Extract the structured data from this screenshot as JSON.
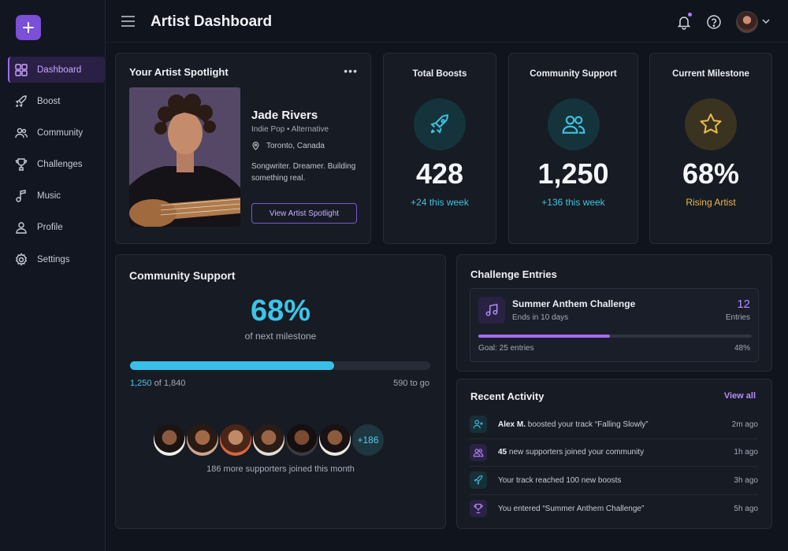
{
  "header": {
    "title": "Artist Dashboard"
  },
  "sidebar": {
    "items": [
      {
        "label": "Dashboard",
        "icon": "grid-icon",
        "active": true
      },
      {
        "label": "Boost",
        "icon": "rocket-icon"
      },
      {
        "label": "Community",
        "icon": "users-icon"
      },
      {
        "label": "Challenges",
        "icon": "trophy-icon"
      },
      {
        "label": "Music",
        "icon": "music-note-icon"
      },
      {
        "label": "Profile",
        "icon": "user-icon"
      },
      {
        "label": "Settings",
        "icon": "gear-icon"
      }
    ]
  },
  "spotlight": {
    "title": "Your Artist Spotlight",
    "name": "Jade Rivers",
    "genre": "Indie Pop • Alternative",
    "location": "Toronto, Canada",
    "bio": "Songwriter. Dreamer. Building something real.",
    "button": "View Artist Spotlight"
  },
  "stats": [
    {
      "title": "Total Boosts",
      "value": "428",
      "sub": "+24 this week",
      "accent": "#3fc3df",
      "icon": "rocket-icon"
    },
    {
      "title": "Community Support",
      "value": "1,250",
      "sub": "+136 this week",
      "accent": "#3fc3df",
      "icon": "users-icon"
    },
    {
      "title": "Current Milestone",
      "value": "68%",
      "sub": "Rising Artist",
      "accent": "#e8b84a",
      "icon": "star-icon"
    }
  ],
  "community": {
    "title": "Community Support",
    "percent": "68%",
    "percent_sub": "of next milestone",
    "progress": 0.68,
    "current": "1,250",
    "of_total": " of 1,840",
    "remaining": "590 to go",
    "more_count": "+186",
    "caption": "186 more supporters joined this month"
  },
  "challenge": {
    "title": "Challenge Entries",
    "name": "Summer Anthem Challenge",
    "ends": "Ends in 10 days",
    "count": "12",
    "entries_label": "Entries",
    "goal": "Goal: 25 entries",
    "percent": "48%",
    "progress": 0.48
  },
  "activity": {
    "title": "Recent Activity",
    "view_all": "View all",
    "items": [
      {
        "bold": "Alex M.",
        "text": " boosted your track “Falling Slowly”",
        "time": "2m ago",
        "icon": "user-plus-icon"
      },
      {
        "bold": "45",
        "text": " new supporters joined your community",
        "time": "1h ago",
        "icon": "users-icon"
      },
      {
        "bold": "",
        "text": "Your track reached 100 new boosts",
        "time": "3h ago",
        "icon": "rocket-icon"
      },
      {
        "bold": "",
        "text": "You entered “Summer Anthem Challenge”",
        "time": "5h ago",
        "icon": "trophy-icon"
      }
    ]
  }
}
